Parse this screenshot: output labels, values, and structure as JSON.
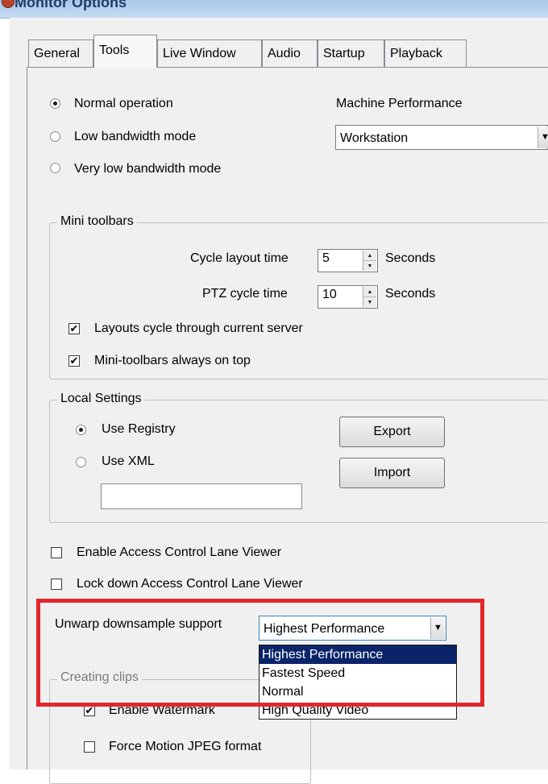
{
  "window": {
    "title": "Monitor Options"
  },
  "tabs": [
    "General",
    "Tools",
    "Live Window",
    "Audio",
    "Startup",
    "Playback"
  ],
  "operation": {
    "options": [
      "Normal operation",
      "Low bandwidth mode",
      "Very low bandwidth mode"
    ],
    "selected": "Normal operation"
  },
  "machine_performance": {
    "label": "Machine Performance",
    "value": "Workstation"
  },
  "mini_toolbars": {
    "legend": "Mini toolbars",
    "cycle_layout": {
      "label": "Cycle layout time",
      "value": "5",
      "unit": "Seconds"
    },
    "ptz_cycle": {
      "label": "PTZ cycle time",
      "value": "10",
      "unit": "Seconds"
    },
    "checks": [
      {
        "label": "Layouts cycle through current server",
        "checked": true
      },
      {
        "label": "Mini-toolbars always on top",
        "checked": true
      }
    ]
  },
  "local_settings": {
    "legend": "Local Settings",
    "options": [
      "Use Registry",
      "Use XML"
    ],
    "selected": "Use Registry",
    "xml_path": "",
    "export_label": "Export",
    "import_label": "Import"
  },
  "access_control": [
    {
      "label": "Enable Access Control Lane Viewer",
      "checked": false
    },
    {
      "label": "Lock down Access Control Lane Viewer",
      "checked": false
    }
  ],
  "unwarp": {
    "label": "Unwarp downsample support",
    "value": "Highest Performance",
    "options": [
      "Highest Performance",
      "Fastest Speed",
      "Normal",
      "High Quality Video"
    ],
    "highlighted": "Highest Performance"
  },
  "clips": {
    "legend": "Creating clips",
    "checks": [
      {
        "label": "Enable Watermark",
        "checked": true
      },
      {
        "label": "Force Motion JPEG format",
        "checked": false
      }
    ]
  },
  "glyphs": {
    "check": "✔",
    "dropdown_arrow": "▼",
    "spin_up": "▲",
    "spin_down": "▼"
  },
  "colors": {
    "highlight_box": "#e3262c",
    "selection": "#0a246a"
  }
}
